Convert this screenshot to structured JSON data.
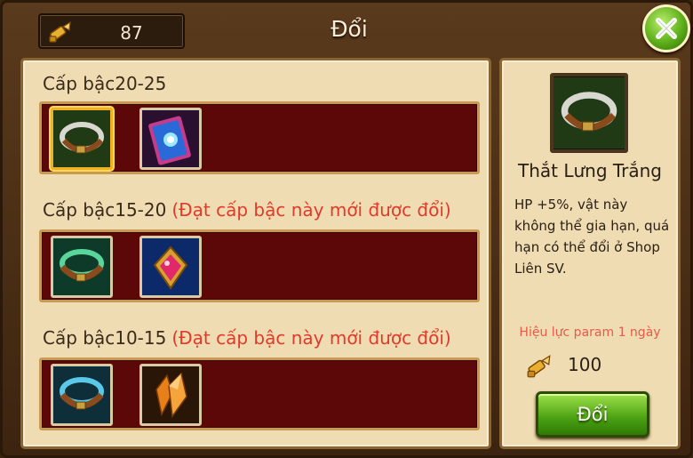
{
  "header": {
    "currency_icon": "bullet-token-icon",
    "currency_value": "87",
    "title": "Đổi",
    "close_icon": "close-x-icon"
  },
  "tiers": [
    {
      "label": "Cấp bậc20-25",
      "warning": "",
      "items": [
        {
          "icon": "white-belt-icon"
        },
        {
          "icon": "blue-card-icon"
        }
      ]
    },
    {
      "label": "Cấp bậc15-20",
      "warning": "(Đạt cấp bậc này mới được đổi)",
      "items": [
        {
          "icon": "green-belt-icon"
        },
        {
          "icon": "red-amulet-icon"
        }
      ]
    },
    {
      "label": "Cấp bậc10-15",
      "warning": "(Đạt cấp bậc này mới được đổi)",
      "items": [
        {
          "icon": "blue-belt-icon"
        },
        {
          "icon": "orange-crystal-icon"
        }
      ]
    }
  ],
  "detail": {
    "name": "Thắt Lưng Trắng",
    "description": "HP +5%, vật này không thể gia hạn, quá hạn có thể đổi ở Shop Liên SV.",
    "validity": "Hiệu lực param 1 ngày",
    "price_icon": "bullet-token-icon",
    "price": "100",
    "button_label": "Đổi"
  },
  "colors": {
    "accent_green": "#4aa012",
    "warning_red": "#e23a2a",
    "strip_bg": "#5c0808",
    "panel_bg": "#efdcb2"
  }
}
